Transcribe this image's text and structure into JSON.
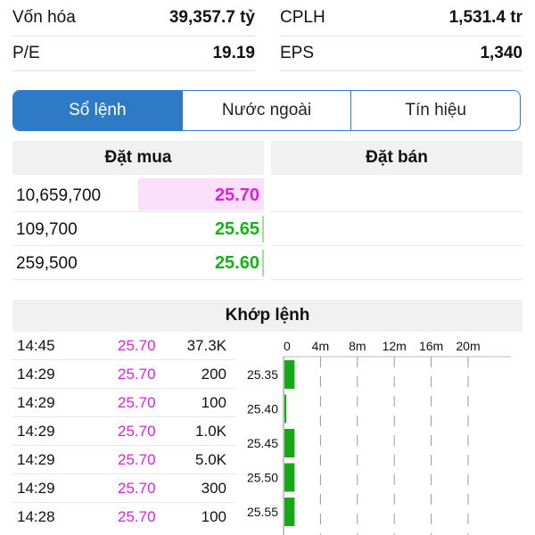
{
  "stats": {
    "row1": {
      "left_label": "Vốn hóa",
      "left_value": "39,357.7 tỷ",
      "right_label": "CPLH",
      "right_value": "1,531.4 tr"
    },
    "row2": {
      "left_label": "P/E",
      "left_value": "19.19",
      "right_label": "EPS",
      "right_value": "1,340"
    }
  },
  "tabs": [
    {
      "label": "Sổ lệnh",
      "active": true
    },
    {
      "label": "Nước ngoài",
      "active": false
    },
    {
      "label": "Tín hiệu",
      "active": false
    }
  ],
  "orderbook": {
    "buy_header": "Đặt mua",
    "sell_header": "Đặt bán",
    "buy_rows": [
      {
        "volume": "10,659,700",
        "price": "25.70",
        "color": "#e020e0",
        "highlight": true
      },
      {
        "volume": "109,700",
        "price": "25.65",
        "color": "#17b217",
        "highlight": false
      },
      {
        "volume": "259,500",
        "price": "25.60",
        "color": "#17b217",
        "highlight": false
      }
    ]
  },
  "matched": {
    "header": "Khớp lệnh",
    "trades": [
      {
        "time": "14:45",
        "price": "25.70",
        "volume": "37.3K"
      },
      {
        "time": "14:29",
        "price": "25.70",
        "volume": "200"
      },
      {
        "time": "14:29",
        "price": "25.70",
        "volume": "100"
      },
      {
        "time": "14:29",
        "price": "25.70",
        "volume": "1.0K"
      },
      {
        "time": "14:29",
        "price": "25.70",
        "volume": "5.0K"
      },
      {
        "time": "14:29",
        "price": "25.70",
        "volume": "300"
      },
      {
        "time": "14:28",
        "price": "25.70",
        "volume": "100"
      }
    ]
  },
  "chart_data": {
    "type": "bar",
    "orientation": "horizontal",
    "x_ticks": [
      "0",
      "4m",
      "8m",
      "12m",
      "16m",
      "20m"
    ],
    "x_tick_values": [
      0,
      4,
      8,
      12,
      16,
      20
    ],
    "categories": [
      "25.35",
      "25.40",
      "25.45",
      "25.50",
      "25.55"
    ],
    "values": [
      0.55,
      0.1,
      0.55,
      0.55,
      0.55
    ],
    "bar_color": "#17a817",
    "grid": true
  }
}
